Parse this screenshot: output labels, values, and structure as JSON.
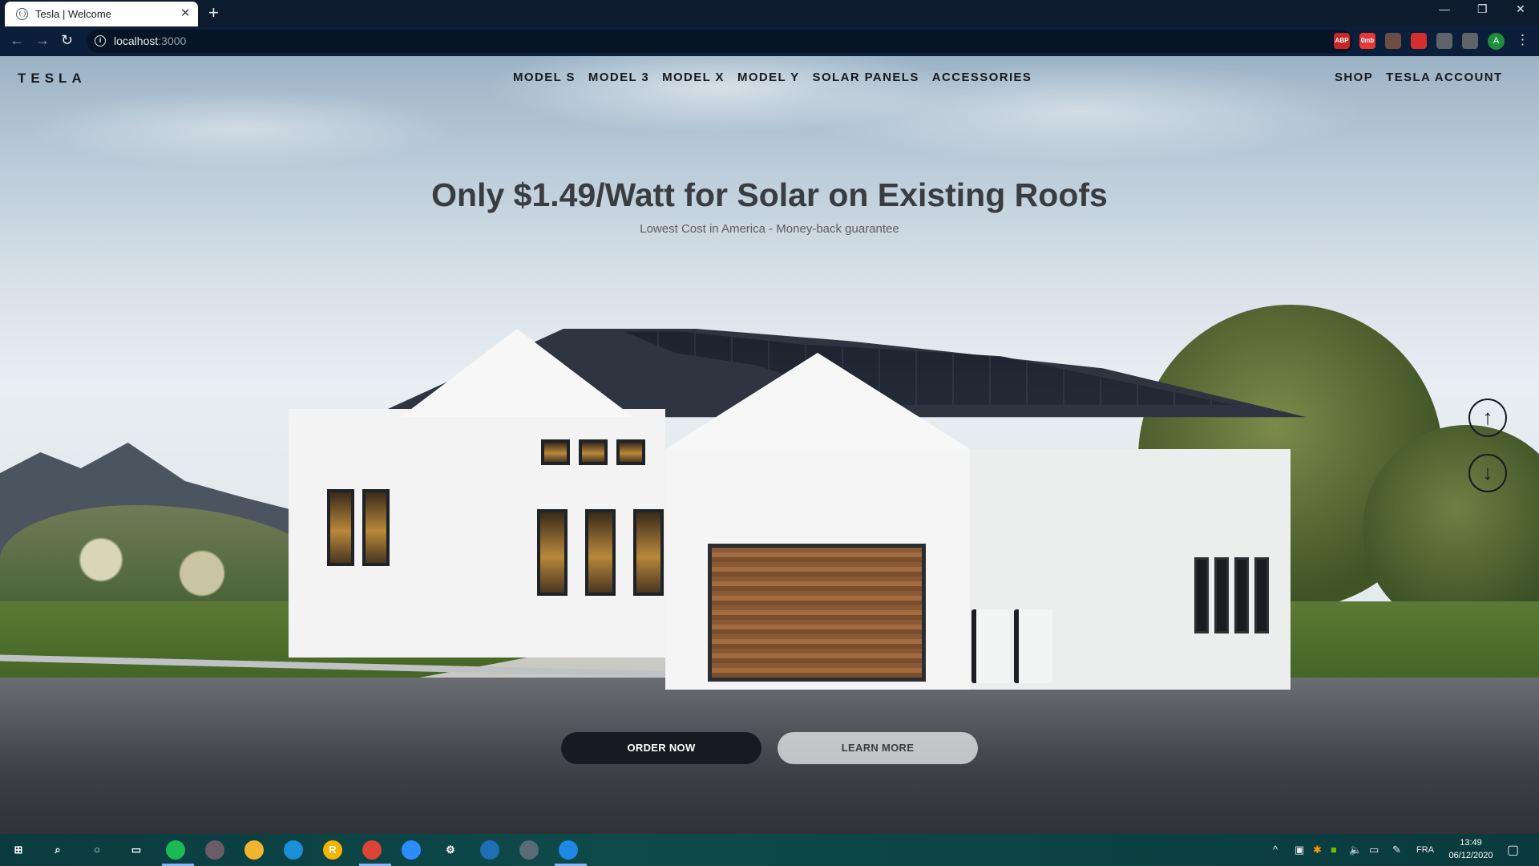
{
  "browser": {
    "tab_title": "Tesla | Welcome",
    "tab_close": "✕",
    "new_tab": "+",
    "url_host": "localhost",
    "url_port": ":3000",
    "window_controls": [
      "—",
      "❐",
      "✕"
    ],
    "extensions": [
      {
        "label": "ABP",
        "color": "#c62828",
        "icon": "adblock-icon"
      },
      {
        "label": "0mb",
        "color": "#e53935",
        "icon": "data-saver-icon"
      },
      {
        "label": "",
        "color": "#6d4c41",
        "icon": "pen-icon"
      },
      {
        "label": "",
        "color": "#d32f2f",
        "icon": "extension-red-icon"
      },
      {
        "label": "",
        "color": "#5f6368",
        "icon": "puzzle-icon"
      },
      {
        "label": "",
        "color": "#5f6368",
        "icon": "media-queue-icon"
      }
    ],
    "profile_initial": "A"
  },
  "nav": {
    "logo": "TESLA",
    "links": [
      "MODEL S",
      "MODEL 3",
      "MODEL X",
      "MODEL Y",
      "SOLAR PANELS",
      "ACCESSORIES"
    ],
    "right_links": [
      "SHOP",
      "TESLA ACCOUNT"
    ]
  },
  "hero": {
    "title": "Only $1.49/Watt for Solar on Existing Roofs",
    "subtitle": "Lowest Cost in America - Money-back guarantee",
    "primary_button": "ORDER NOW",
    "secondary_button": "LEARN MORE",
    "scroll_up": "↑",
    "scroll_down": "↓"
  },
  "taskbar": {
    "apps": [
      {
        "icon": "windows-start-icon",
        "label": "⊞",
        "color": "transparent"
      },
      {
        "icon": "search-icon",
        "label": "⌕",
        "color": "transparent"
      },
      {
        "icon": "cortana-icon",
        "label": "○",
        "color": "transparent"
      },
      {
        "icon": "task-view-icon",
        "label": "▭",
        "color": "transparent"
      },
      {
        "icon": "spotify-icon",
        "label": "",
        "color": "#1db954"
      },
      {
        "icon": "media-player-icon",
        "label": "",
        "color": "#6a5d68"
      },
      {
        "icon": "file-explorer-icon",
        "label": "",
        "color": "#f2b531"
      },
      {
        "icon": "edge-icon",
        "label": "",
        "color": "#1a8fd8"
      },
      {
        "icon": "rockstar-icon",
        "label": "R",
        "color": "#f5b400"
      },
      {
        "icon": "chrome-icon",
        "label": "",
        "color": "#db4437"
      },
      {
        "icon": "zoom-icon",
        "label": "",
        "color": "#2d8cff"
      },
      {
        "icon": "settings-icon",
        "label": "⚙",
        "color": "transparent"
      },
      {
        "icon": "store-icon",
        "label": "",
        "color": "#1f6fb5"
      },
      {
        "icon": "calculator-icon",
        "label": "",
        "color": "#5a6b75"
      },
      {
        "icon": "vscode-icon",
        "label": "",
        "color": "#1e88e5"
      }
    ],
    "tray": [
      "^",
      "FRA"
    ],
    "time": "13:49",
    "date": "06/12/2020"
  },
  "colors": {
    "primary_button_bg": "#171a20",
    "secondary_button_bg": "#f4f4f4",
    "text_dark": "#171a20"
  }
}
